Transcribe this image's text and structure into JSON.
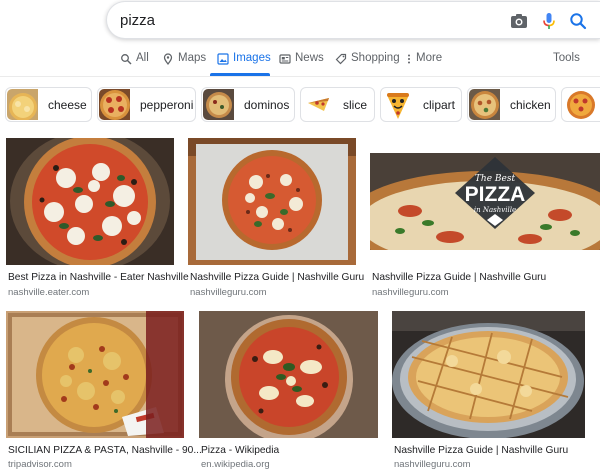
{
  "search": {
    "query": "pizza",
    "icons": [
      "camera-icon",
      "microphone-icon",
      "search-icon"
    ],
    "mic_colors": [
      "#4285f4",
      "#ea4335",
      "#fbbc04",
      "#34a853"
    ],
    "search_icon_color": "#1a73e8"
  },
  "tabs": [
    {
      "label": "All",
      "icon": "search-icon"
    },
    {
      "label": "Maps",
      "icon": "map-pin-icon"
    },
    {
      "label": "Images",
      "icon": "image-icon"
    },
    {
      "label": "News",
      "icon": "news-icon"
    },
    {
      "label": "Shopping",
      "icon": "tag-icon"
    },
    {
      "label": "More",
      "icon": "more-vert-icon"
    }
  ],
  "active_tab": "Images",
  "tools_label": "Tools",
  "accent_color": "#1a73e8",
  "chips": [
    {
      "label": "cheese"
    },
    {
      "label": "pepperoni"
    },
    {
      "label": "dominos"
    },
    {
      "label": "slice"
    },
    {
      "label": "clipart"
    },
    {
      "label": "chicken"
    }
  ],
  "results": [
    {
      "title": "Best Pizza in Nashville - Eater Nashville",
      "source": "nashville.eater.com"
    },
    {
      "title": "Nashville Pizza Guide | Nashville Guru",
      "source": "nashvilleguru.com"
    },
    {
      "title": "Nashville Pizza Guide | Nashville Guru",
      "source": "nashvilleguru.com",
      "overlay": {
        "line1": "The Best",
        "line2": "PIZZA",
        "line3": "in Nashville"
      }
    },
    {
      "title": "SICILIAN PIZZA & PASTA, Nashville - 90...",
      "source": "tripadvisor.com"
    },
    {
      "title": "Pizza - Wikipedia",
      "source": "en.wikipedia.org"
    },
    {
      "title": "Nashville Pizza Guide | Nashville Guru",
      "source": "nashvilleguru.com"
    }
  ]
}
